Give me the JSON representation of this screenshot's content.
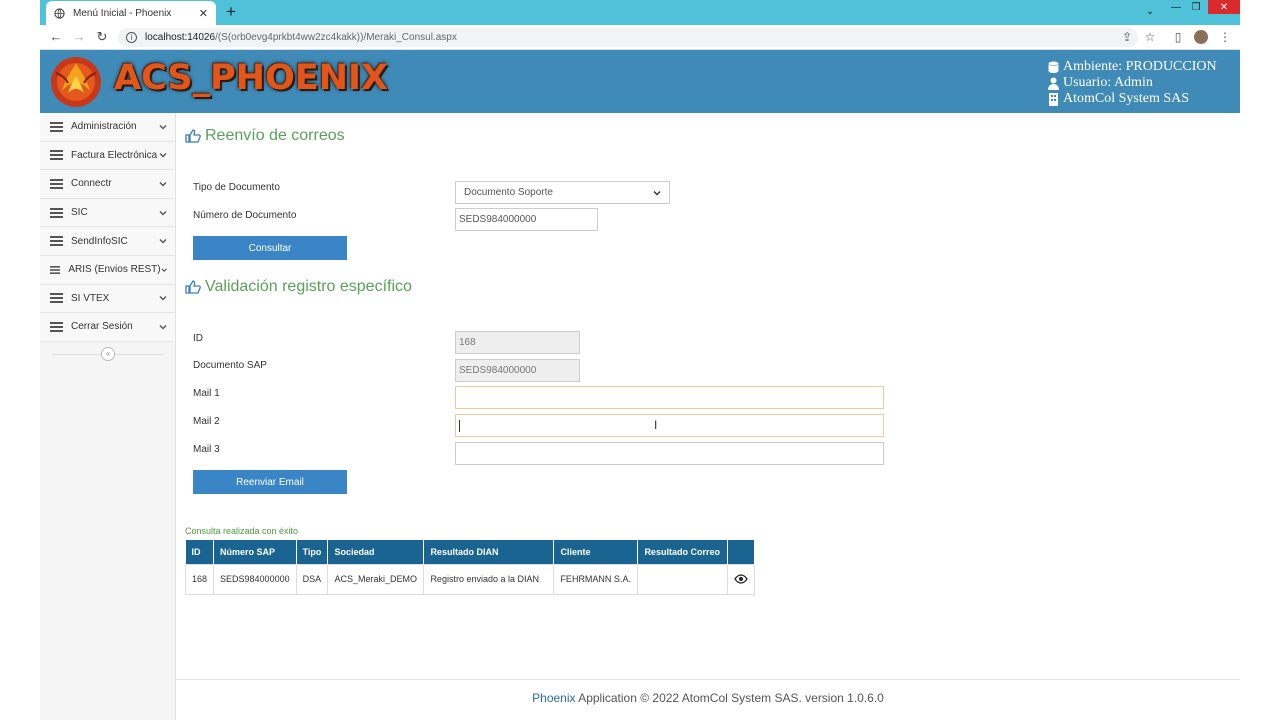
{
  "browser": {
    "tab_title": "Menú Inicial - Phoenix",
    "tab_close": "✕",
    "new_tab": "+",
    "url_host": "localhost:14026",
    "url_path": "/(S(orb0evg4prkbt4ww2zc4kakk))/Meraki_Consul.aspx"
  },
  "header": {
    "logo_text": "ACS_PHOENIX",
    "environment": "Ambiente: PRODUCCION",
    "user": "Usuario: Admin",
    "company": "AtomCol System SAS"
  },
  "sidebar": {
    "items": [
      {
        "label": "Administración"
      },
      {
        "label": "Factura Electrónica"
      },
      {
        "label": "Connectr"
      },
      {
        "label": "SIC"
      },
      {
        "label": "SendInfoSIC"
      },
      {
        "label": "ARIS (Envios REST)"
      },
      {
        "label": "SI VTEX"
      },
      {
        "label": "Cerrar Sesión"
      }
    ]
  },
  "resend": {
    "title": "Reenvío de correos",
    "doc_type_label": "Tipo de Documento",
    "doc_type_value": "Documento Soporte",
    "doc_number_label": "Número de Documento",
    "doc_number_value": "SEDS984000000",
    "consult_button": "Consultar"
  },
  "validation": {
    "title": "Validación registro específico",
    "id_label": "ID",
    "id_value": "168",
    "sap_label": "Documento SAP",
    "sap_value": "SEDS984000000",
    "mail1_label": "Mail 1",
    "mail1_value": "",
    "mail2_label": "Mail 2",
    "mail2_value": "",
    "mail3_label": "Mail 3",
    "mail3_value": "",
    "resend_button": "Reenviar Email"
  },
  "results": {
    "status": "Consulta realizada con éxito",
    "columns": [
      "ID",
      "Número SAP",
      "Tipo",
      "Sociedad",
      "Resultado DIAN",
      "Cliente",
      "Resultado Correo",
      ""
    ],
    "rows": [
      {
        "id": "168",
        "sap": "SEDS984000000",
        "tipo": "DSA",
        "sociedad": "ACS_Meraki_DEMO",
        "dian": "Registro enviado a la DIAN",
        "cliente": "FEHRMANN S.A.",
        "correo": ""
      }
    ]
  },
  "footer": {
    "brand": "Phoenix",
    "text": " Application © 2022 AtomCol System SAS. version 1.0.6.0"
  },
  "colors": {
    "header_bg": "#3f8ab7",
    "tabstrip_bg": "#4fc1d8",
    "button_bg": "#3a85c5",
    "table_header_bg": "#1a6491",
    "section_title": "#5aa05a",
    "success_text": "#4b9a3a"
  }
}
